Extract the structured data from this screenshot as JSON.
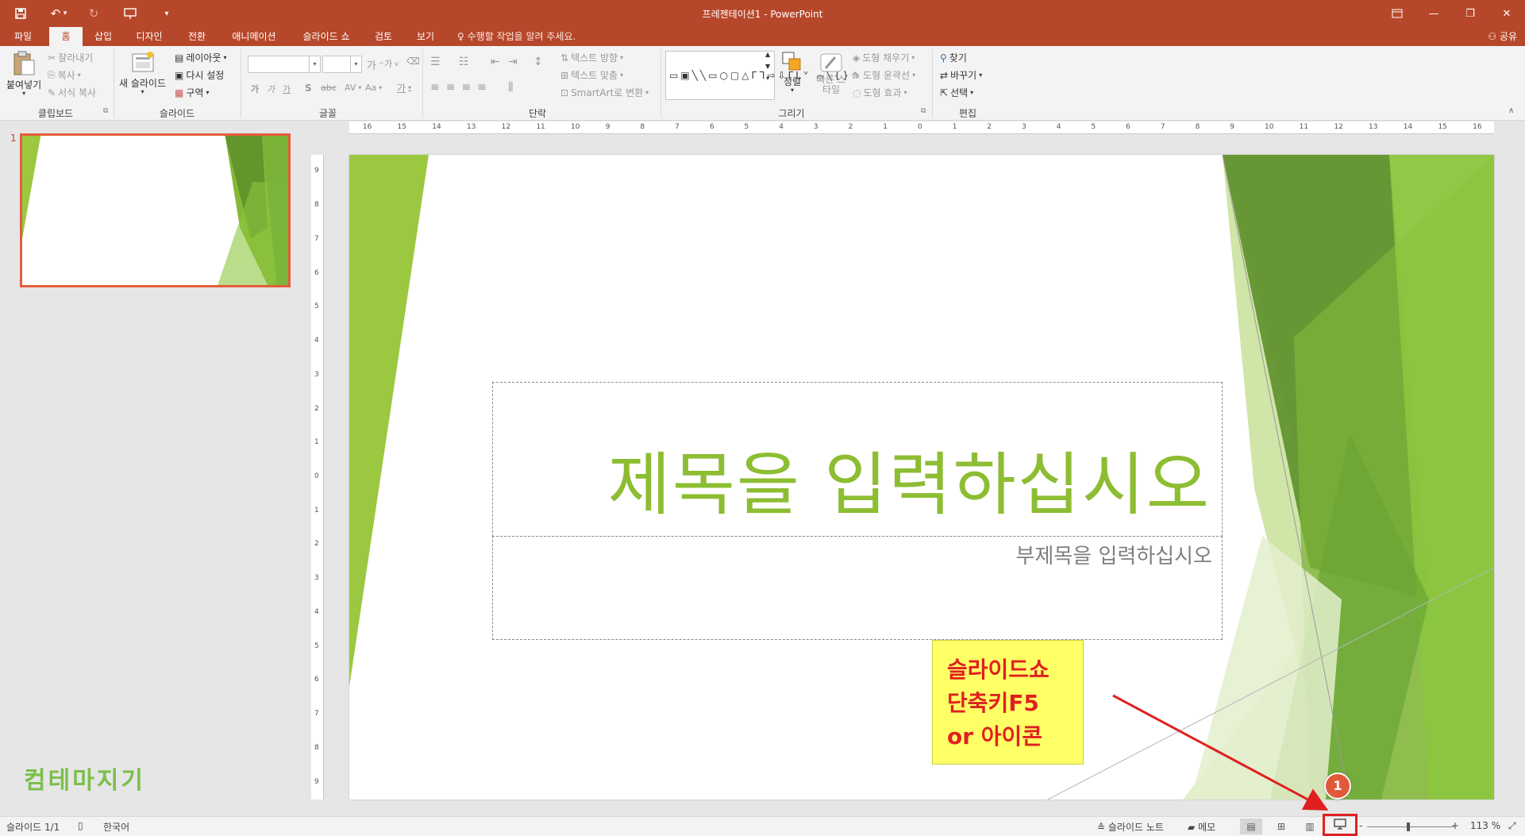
{
  "titlebar": {
    "title": "프레젠테이션1 - PowerPoint",
    "quick_access": [
      "save-icon",
      "undo-icon",
      "redo-icon",
      "start-from-beginning-icon",
      "customize-icon"
    ]
  },
  "tabs": [
    "파일",
    "홈",
    "삽입",
    "디자인",
    "전환",
    "애니메이션",
    "슬라이드 쇼",
    "검토",
    "보기"
  ],
  "tell_me": "수행할 작업을 알려 주세요.",
  "share": "공유",
  "ribbon": {
    "clipboard": {
      "label": "클립보드",
      "paste": "붙여넣기",
      "cut": "잘라내기",
      "copy": "복사",
      "format_painter": "서식 복사"
    },
    "slides": {
      "label": "슬라이드",
      "new_slide": "새 슬라이드",
      "layout": "레이아웃",
      "reset": "다시 설정",
      "section": "구역"
    },
    "font": {
      "label": "글꼴",
      "bold": "가",
      "italic": "가",
      "underline": "가",
      "shadow": "S",
      "strike": "abc",
      "spacing": "AV",
      "case": "Aa",
      "color": "가",
      "grow": "가",
      "shrink": "가"
    },
    "paragraph": {
      "label": "단락",
      "text_direction": "텍스트 방향",
      "align_text": "텍스트 맞춤",
      "smartart": "SmartArt로 변환"
    },
    "drawing": {
      "label": "그리기",
      "arrange": "정렬",
      "quick_styles": "빠른 스타일",
      "fill": "도형 채우기",
      "outline": "도형 윤곽선",
      "effects": "도형 효과"
    },
    "editing": {
      "label": "편집",
      "find": "찾기",
      "replace": "바꾸기",
      "select": "선택"
    }
  },
  "thumbnail": {
    "number": "1"
  },
  "ruler": {
    "h_ticks": [
      "16",
      "15",
      "14",
      "13",
      "12",
      "11",
      "10",
      "9",
      "8",
      "7",
      "6",
      "5",
      "4",
      "3",
      "2",
      "1",
      "0",
      "1",
      "2",
      "3",
      "4",
      "5",
      "6",
      "7",
      "8",
      "9",
      "10",
      "11",
      "12",
      "13",
      "14",
      "15",
      "16"
    ],
    "v_ticks": [
      "9",
      "8",
      "7",
      "6",
      "5",
      "4",
      "3",
      "2",
      "1",
      "0",
      "1",
      "2",
      "3",
      "4",
      "5",
      "6",
      "7",
      "8",
      "9"
    ]
  },
  "slide": {
    "title_placeholder": "제목을 입력하십시오",
    "subtitle_placeholder": "부제목을 입력하십시오"
  },
  "annotation": {
    "line1": "슬라이드쇼",
    "line2": "단축키F5",
    "line3": "or 아이콘",
    "badge": "1",
    "color": "#e02020"
  },
  "watermark": "컴테마지기",
  "statusbar": {
    "slide_count": "슬라이드 1/1",
    "language": "한국어",
    "notes": "슬라이드 노트",
    "comments": "메모",
    "zoom_minus": "-",
    "zoom_plus": "+",
    "zoom_level": "113 %",
    "zoom_fraction": 0.45
  },
  "colors": {
    "accent": "#b7472a",
    "title_green": "#8dbd32"
  }
}
